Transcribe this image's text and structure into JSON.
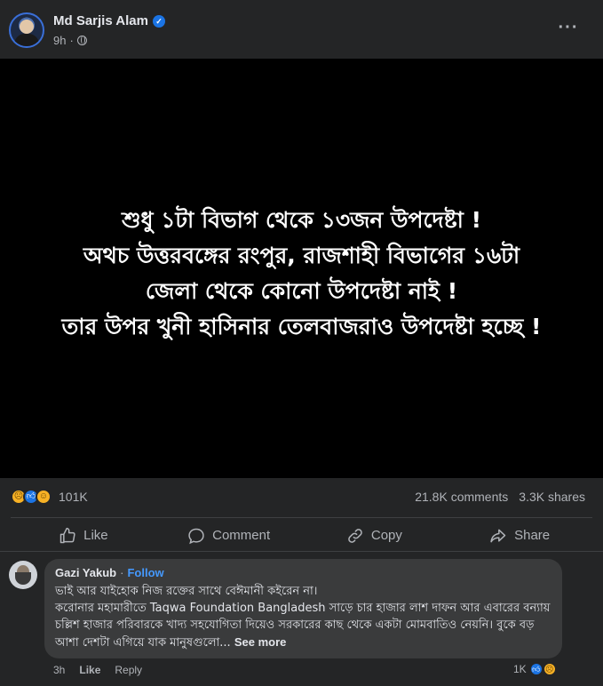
{
  "post": {
    "author": "Md Sarjis Alam",
    "verified_icon": "verified-badge-icon",
    "time": "9h",
    "privacy_separator": "·",
    "privacy_icon": "globe-icon",
    "more_label": "···"
  },
  "image": {
    "lines": [
      "শুধু ১টা বিভাগ থেকে ১৩জন উপদেষ্টা !",
      "অথচ উত্তরবঙ্গের রংপুর, রাজশাহী বিভাগের ১৬টা",
      "জেলা থেকে কোনো উপদেষ্টা নাই !",
      "তার উপর খুনী হাসিনার তেলবাজরাও উপদেষ্টা হচ্ছে !"
    ]
  },
  "stats": {
    "reaction_count": "101K",
    "comments": "21.8K comments",
    "shares": "3.3K shares"
  },
  "actions": {
    "like": "Like",
    "comment": "Comment",
    "copy": "Copy",
    "share": "Share"
  },
  "comment": {
    "name": "Gazi Yakub",
    "dot": "·",
    "follow": "Follow",
    "line1": "ভাই আর যাইহোক নিজ রক্তের সাথে বেঈমানী কইরেন না।",
    "line2": "করোনার মহামারীতে Taqwa Foundation Bangladesh সাড়ে চার হাজার লাশ দাফন আর এবারের বন্যায় চল্লিশ হাজার পরিবারকে খাদ্য সহযোগিতা দিয়েও সরকারের কাছ থেকে একটা মোমবাতিও নেয়নি। বুকে বড় আশা দেশটা এগিয়ে যাক মানুষগুলো...",
    "see_more": "See more",
    "time": "3h",
    "like": "Like",
    "reply": "Reply",
    "reaction_count": "1K"
  },
  "colors": {
    "background": "#242526",
    "image_bg": "#000000",
    "link_blue": "#4599ff",
    "like_blue": "#1b74e4",
    "emoji_yellow": "#f7b125"
  }
}
